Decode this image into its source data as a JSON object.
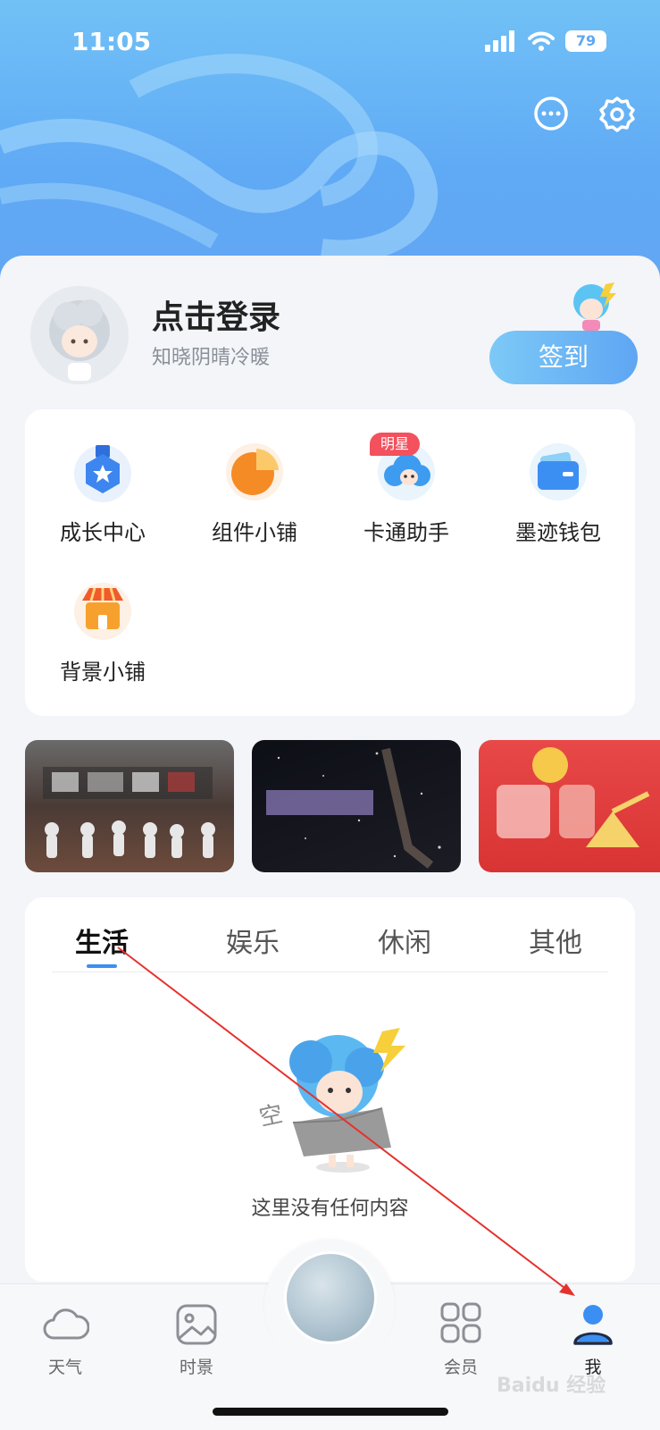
{
  "status_bar": {
    "time": "11:05",
    "battery": "79"
  },
  "header": {
    "message_icon": "message-bubble-icon",
    "settings_icon": "gear-icon"
  },
  "profile": {
    "login_title": "点击登录",
    "subtitle": "知晓阴晴冷暖",
    "checkin_label": "签到"
  },
  "services": [
    {
      "label": "成长中心",
      "icon": "growth-medal-icon"
    },
    {
      "label": "组件小铺",
      "icon": "widget-pie-icon"
    },
    {
      "label": "卡通助手",
      "icon": "cartoon-cloud-icon",
      "badge": "明星"
    },
    {
      "label": "墨迹钱包",
      "icon": "wallet-icon"
    },
    {
      "label": "背景小铺",
      "icon": "shop-awning-icon"
    }
  ],
  "tabs": [
    {
      "label": "生活",
      "active": true
    },
    {
      "label": "娱乐",
      "active": false
    },
    {
      "label": "休闲",
      "active": false
    },
    {
      "label": "其他",
      "active": false
    }
  ],
  "empty": {
    "stamp": "空",
    "message": "这里没有任何内容"
  },
  "bottom_nav": [
    {
      "label": "天气",
      "icon": "cloud-icon",
      "active": false
    },
    {
      "label": "时景",
      "icon": "image-icon",
      "active": false
    },
    {
      "label": "会员",
      "icon": "grid-icon",
      "active": false
    },
    {
      "label": "我",
      "icon": "person-icon",
      "active": true
    }
  ],
  "watermark": "Baidu 经验",
  "colors": {
    "accent": "#5fa6f3",
    "badge": "#f2515d",
    "annotation_arrow": "#e5322d"
  }
}
